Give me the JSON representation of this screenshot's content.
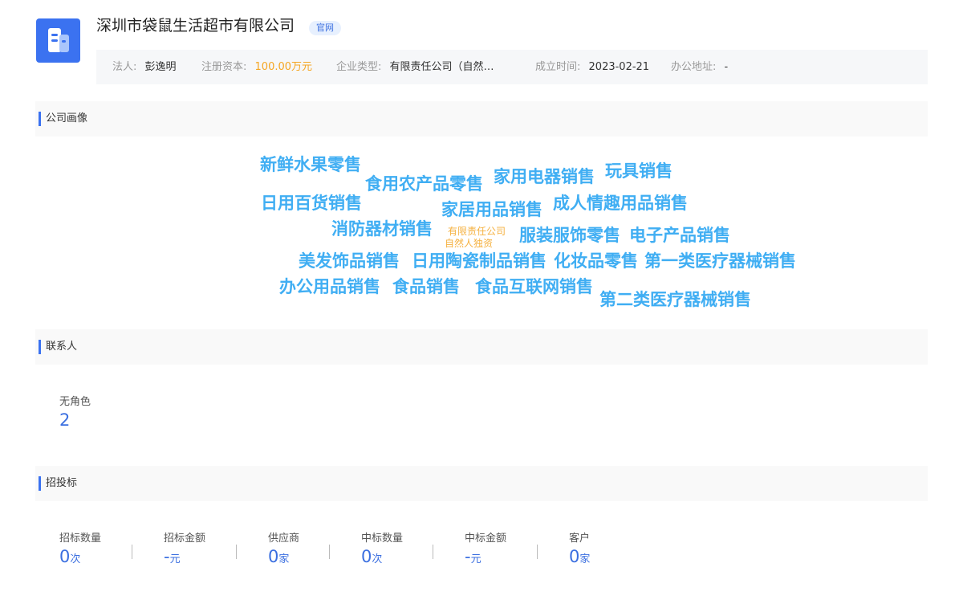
{
  "company": {
    "name": "深圳市袋鼠生活超市有限公司",
    "official_badge": "官网",
    "logo_color": "#3b72f0"
  },
  "info": {
    "legal_rep_label": "法人:",
    "legal_rep_value": "彭逸明",
    "capital_label": "注册资本:",
    "capital_value": "100.00万元",
    "type_label": "企业类型:",
    "type_value": "有限责任公司（自然…",
    "founded_label": "成立时间:",
    "founded_value": "2023-02-21",
    "address_label": "办公地址:",
    "address_value": "-"
  },
  "sections": {
    "portrait": "公司画像",
    "contacts": "联系人",
    "bidding": "招投标"
  },
  "word_cloud": {
    "center_line1": "有限责任公司",
    "center_line2": "自然人独资",
    "words": [
      "新鲜水果零售",
      "食用农产品零售",
      "家用电器销售",
      "玩具销售",
      "日用百货销售",
      "家居用品销售",
      "成人情趣用品销售",
      "消防器材销售",
      "服装服饰零售",
      "电子产品销售",
      "美发饰品销售",
      "日用陶瓷制品销售",
      "化妆品零售",
      "第一类医疗器械销售",
      "办公用品销售",
      "食品销售",
      "食品互联网销售",
      "第二类医疗器械销售"
    ],
    "word_color": "#40aef3",
    "center_color": "#f5b140"
  },
  "contacts": {
    "role_label": "无角色",
    "role_count": "2"
  },
  "bidding": {
    "items": [
      {
        "label": "招标数量",
        "value": "0",
        "unit": "次"
      },
      {
        "label": "招标金额",
        "value": "-",
        "unit": "元"
      },
      {
        "label": "供应商",
        "value": "0",
        "unit": "家"
      },
      {
        "label": "中标数量",
        "value": "0",
        "unit": "次"
      },
      {
        "label": "中标金额",
        "value": "-",
        "unit": "元"
      },
      {
        "label": "客户",
        "value": "0",
        "unit": "家"
      }
    ]
  }
}
